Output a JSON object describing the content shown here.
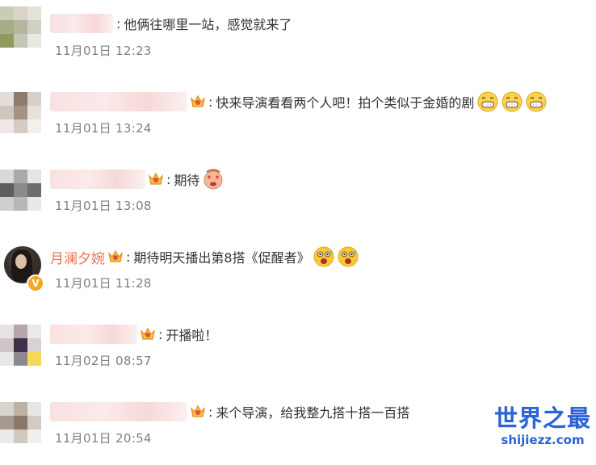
{
  "comments": [
    {
      "user": "",
      "text": "他俩往哪里一站，感觉就来了",
      "time": "11月01日 12:23",
      "emojis": []
    },
    {
      "user": "",
      "text": "快来导演看看两个人吧！拍个类似于金婚的剧",
      "time": "11月01日 13:24",
      "emojis": [
        "grin-emoji",
        "grin-emoji",
        "grin-emoji"
      ]
    },
    {
      "user": "",
      "text": "期待",
      "time": "11月01日 13:08",
      "emojis": [
        "heart-eyes-emoji"
      ]
    },
    {
      "user": "月澜夕婉",
      "text": "期待明天播出第8搭《促醒者》",
      "time": "11月01日 11:28",
      "emojis": [
        "excited-emoji",
        "excited-emoji"
      ]
    },
    {
      "user": "",
      "text": "开播啦！",
      "time": "11月02日 08:57",
      "emojis": []
    },
    {
      "user": "",
      "text": "来个导演，给我整九搭十搭一百搭",
      "time": "11月01日 20:54",
      "emojis": []
    }
  ],
  "watermark": {
    "title": "世界之最",
    "url": "shijiezz.com"
  },
  "colors": {
    "username": "#eb7350",
    "time": "#808080",
    "text": "#333333",
    "watermark": "#2b63d6"
  }
}
